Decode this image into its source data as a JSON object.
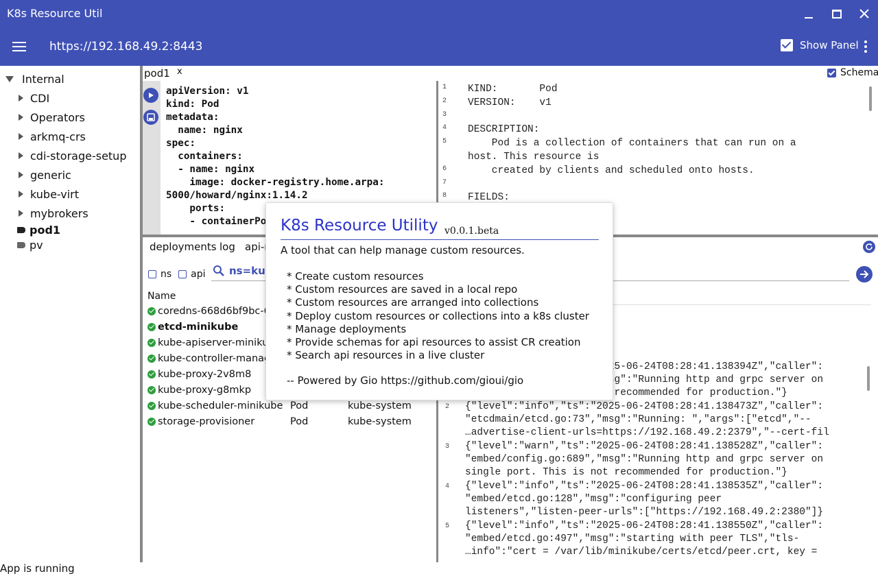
{
  "window": {
    "title": "K8s Resource Util"
  },
  "appbar": {
    "url": "https://192.168.49.2:8443",
    "show_panel_label": "Show Panel"
  },
  "tree": {
    "root": "Internal",
    "items": [
      "CDI",
      "Operators",
      "arkmq-crs",
      "cdi-storage-setup",
      "generic",
      "kube-virt",
      "mybrokers"
    ],
    "leaves": [
      "pod1",
      "pv"
    ]
  },
  "editor": {
    "tab_label": "pod1",
    "tab_close": "x",
    "schema_label": "Schema",
    "yaml_lines": [
      "apiVersion: v1",
      "kind: Pod",
      "metadata:",
      "  name: nginx",
      "spec:",
      "  containers:",
      "  - name: nginx",
      "    image: docker-registry.home.arpa:",
      "5000/howard/nginx:1.14.2",
      "    ports:",
      "    - containerPort: 80"
    ]
  },
  "schema_panel": {
    "lines": [
      {
        "n": "1",
        "text": "KIND:       Pod"
      },
      {
        "n": "2",
        "text": "VERSION:    v1"
      },
      {
        "n": "3",
        "text": ""
      },
      {
        "n": "4",
        "text": "DESCRIPTION:"
      },
      {
        "n": "5",
        "text": "    Pod is a collection of containers that can run on a"
      },
      {
        "n": "",
        "text": "host. This resource is"
      },
      {
        "n": "6",
        "text": "    created by clients and scheduled onto hosts."
      },
      {
        "n": "7",
        "text": ""
      },
      {
        "n": "8",
        "text": "FIELDS:"
      }
    ]
  },
  "bottom": {
    "tabs": [
      "deployments",
      "log",
      "api-r"
    ],
    "filter_ns": "ns",
    "filter_api": "api",
    "search_query": "ns=kube",
    "name_header": "Name",
    "rows": [
      {
        "name": "coredns-668d6bf9bc-6",
        "kind": "",
        "ns": ""
      },
      {
        "name": "etcd-minikube",
        "kind": "",
        "ns": ""
      },
      {
        "name": "kube-apiserver-minikub",
        "kind": "",
        "ns": ""
      },
      {
        "name": "kube-controller-manag",
        "kind": "",
        "ns": ""
      },
      {
        "name": "kube-proxy-2v8m8",
        "kind": "",
        "ns": ""
      },
      {
        "name": "kube-proxy-g8mkp",
        "kind": "",
        "ns": ""
      },
      {
        "name": "kube-scheduler-minikube",
        "kind": "Pod",
        "ns": "kube-system"
      },
      {
        "name": "storage-provisioner",
        "kind": "Pod",
        "ns": "kube-system"
      }
    ]
  },
  "log": {
    "lines": [
      {
        "n": "",
        "rows": [
          "{\"level\":\"warn\",\"ts\":\"2025-06-24T08:28:41.138394Z\",\"caller\":",
          "\"embed/config.go:689\",\"msg\":\"Running http and grpc server on",
          "single port. This is not recommended for production.\"}"
        ]
      },
      {
        "n": "2",
        "rows": [
          "{\"level\":\"info\",\"ts\":\"2025-06-24T08:28:41.138473Z\",\"caller\":",
          "\"etcdmain/etcd.go:73\",\"msg\":\"Running: \",\"args\":[\"etcd\",\"--",
          "…advertise-client-urls=https://192.168.49.2:2379\",\"--cert-fil"
        ]
      },
      {
        "n": "3",
        "rows": [
          "{\"level\":\"warn\",\"ts\":\"2025-06-24T08:28:41.138528Z\",\"caller\":",
          "\"embed/config.go:689\",\"msg\":\"Running http and grpc server on",
          "single port. This is not recommended for production.\"}"
        ]
      },
      {
        "n": "4",
        "rows": [
          "{\"level\":\"info\",\"ts\":\"2025-06-24T08:28:41.138535Z\",\"caller\":",
          "\"embed/etcd.go:128\",\"msg\":\"configuring peer",
          "listeners\",\"listen-peer-urls\":[\"https://192.168.49.2:2380\"]}"
        ]
      },
      {
        "n": "5",
        "rows": [
          "{\"level\":\"info\",\"ts\":\"2025-06-24T08:28:41.138550Z\",\"caller\":",
          "\"embed/etcd.go:497\",\"msg\":\"starting with peer TLS\",\"tls-",
          "…info\":\"cert = /var/lib/minikube/certs/etcd/peer.crt, key ="
        ]
      }
    ]
  },
  "about": {
    "title": "K8s Resource Utility",
    "version": "v0.0.1.beta",
    "description": "A tool that can help manage custom resources.",
    "features": [
      "* Create custom resources",
      "* Custom resources are saved in a local repo",
      "* Custom resources are arranged into collections",
      "* Deploy custom resources or collections into a k8s cluster",
      "* Manage deployments",
      "* Provide schemas for api resources to assist CR creation",
      "* Search api resources in a live cluster"
    ],
    "footer": "-- Powered by Gio https://github.com/gioui/gio"
  },
  "status": {
    "text": "App is running"
  },
  "colors": {
    "accent": "#3f51b5",
    "ok": "#2e9e3e",
    "popup_title": "#2b33c8"
  }
}
